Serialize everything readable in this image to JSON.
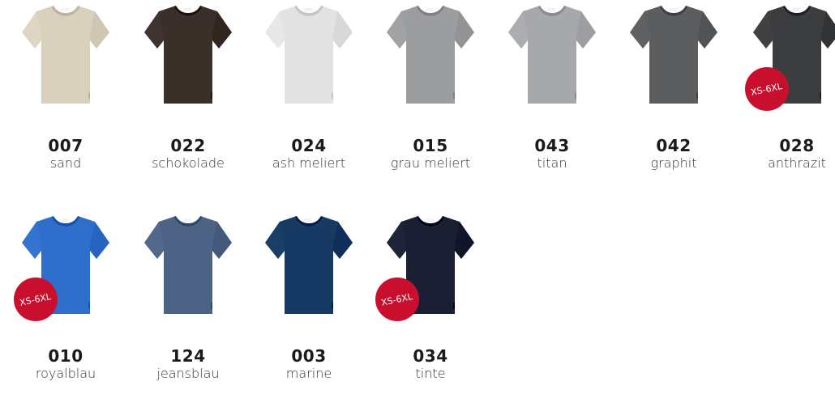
{
  "colors": [
    {
      "code": "007",
      "name": "sand",
      "hex": "#d9d1bd",
      "badge": ""
    },
    {
      "code": "022",
      "name": "schokolade",
      "hex": "#3b2f2a",
      "badge": ""
    },
    {
      "code": "024",
      "name": "ash meliert",
      "hex": "#e2e2e3",
      "badge": ""
    },
    {
      "code": "015",
      "name": "grau meliert",
      "hex": "#9c9d9f",
      "badge": ""
    },
    {
      "code": "043",
      "name": "titan",
      "hex": "#a6a8ab",
      "badge": ""
    },
    {
      "code": "042",
      "name": "graphit",
      "hex": "#5b5d5f",
      "badge": ""
    },
    {
      "code": "028",
      "name": "anthrazit",
      "hex": "#3c3d3f",
      "badge": "XS-6XL"
    },
    {
      "code": "010",
      "name": "royalblau",
      "hex": "#2f6fcb",
      "badge": "XS-6XL"
    },
    {
      "code": "124",
      "name": "jeansblau",
      "hex": "#4d6385",
      "badge": ""
    },
    {
      "code": "003",
      "name": "marine",
      "hex": "#163a63",
      "badge": ""
    },
    {
      "code": "034",
      "name": "tinte",
      "hex": "#1b1f33",
      "badge": "XS-6XL"
    }
  ],
  "badge_color": "#c8102e"
}
